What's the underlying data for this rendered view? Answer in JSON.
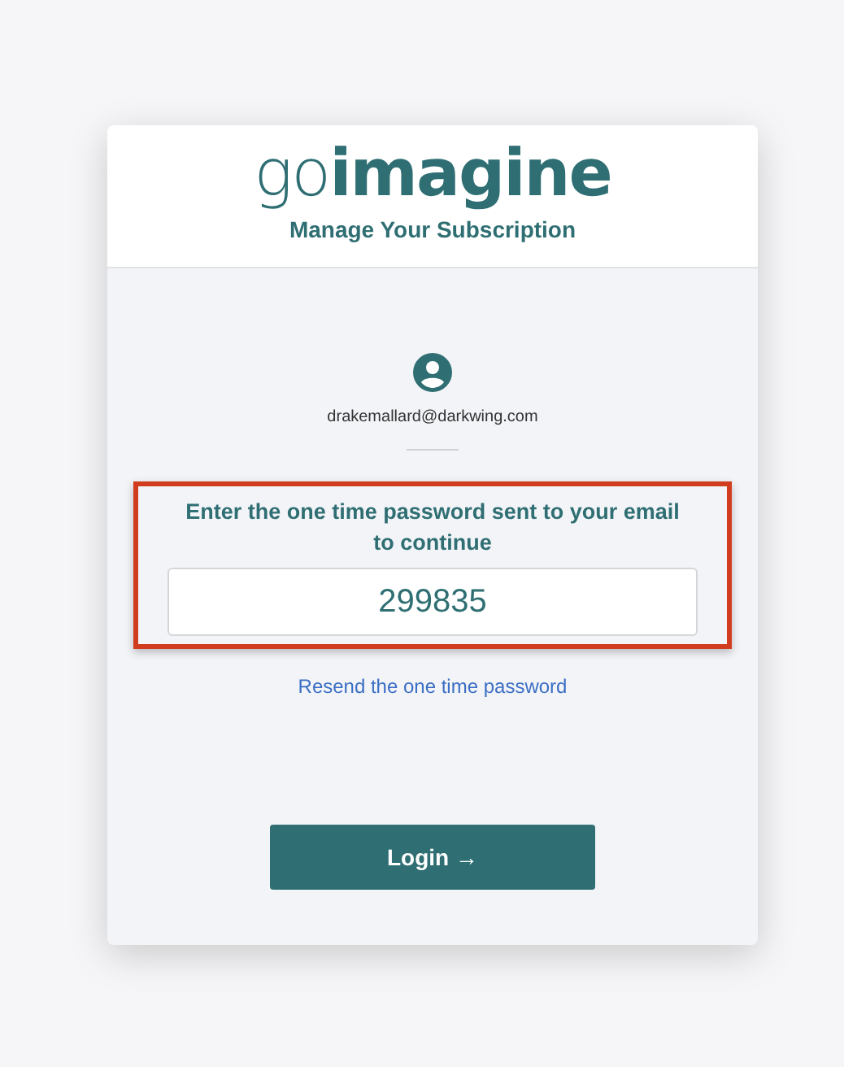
{
  "logo": {
    "text": "go**imagine**"
  },
  "header": {
    "title": "Manage Your Subscription"
  },
  "account": {
    "email": "drakemallard@darkwing.com"
  },
  "otp": {
    "prompt": "Enter the one time password sent to your email to continue",
    "value": "299835",
    "highlighted": true
  },
  "resend_link": "Resend the one time password",
  "login_button": "Login →"
}
